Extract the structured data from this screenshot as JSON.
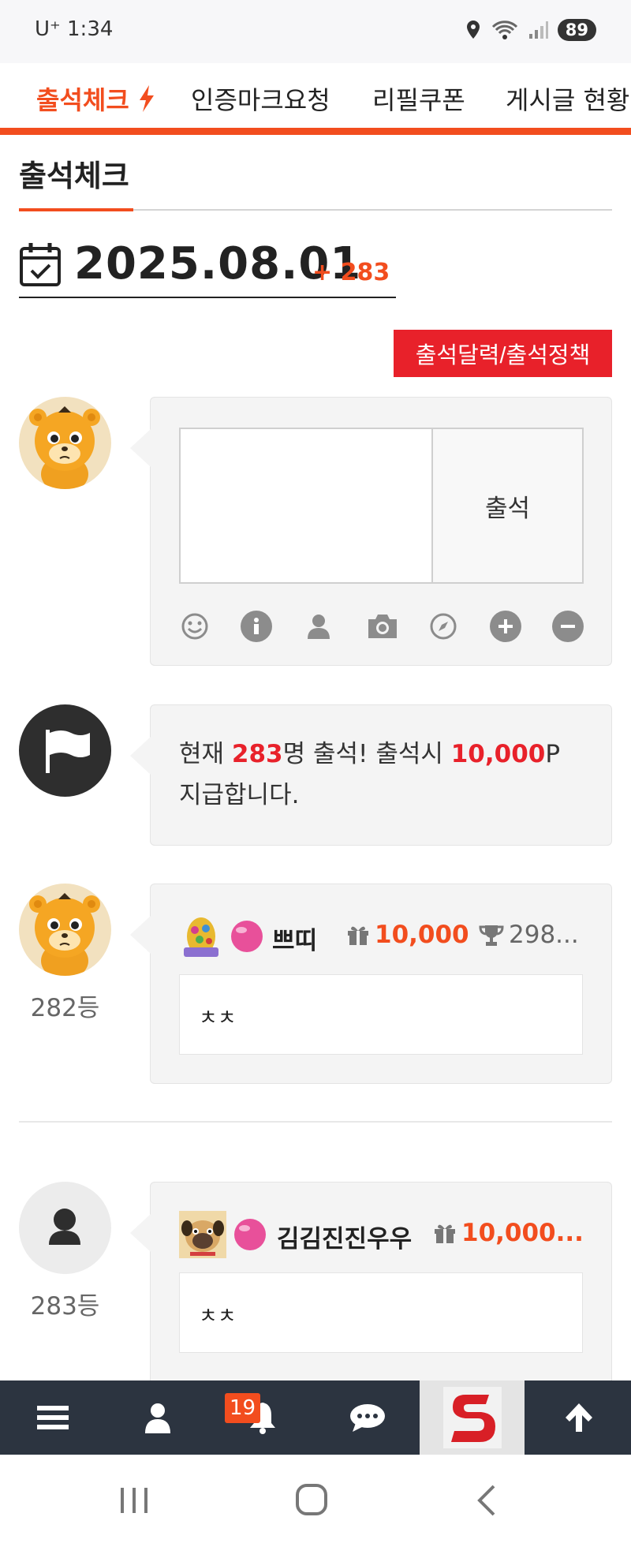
{
  "status_bar": {
    "carrier_time": "U⁺ 1:34",
    "battery": "89"
  },
  "top_nav": {
    "tabs": [
      {
        "label": "출석체크"
      },
      {
        "label": "인증마크요청"
      },
      {
        "label": "리필쿠폰"
      },
      {
        "label": "게시글 현황"
      }
    ]
  },
  "page": {
    "title": "출석체크"
  },
  "date": {
    "value": "2025.08.01",
    "count": "+ 283"
  },
  "policy_button": "출석달력/출석정책",
  "compose": {
    "submit_label": "출석"
  },
  "info": {
    "prefix": "현재 ",
    "count": "283",
    "middle": "명 출석! 출석시 ",
    "points": "10,000",
    "suffix": "P 지급합니다."
  },
  "entries": [
    {
      "rank": "282등",
      "nickname": "쁘띠",
      "points": "10,000",
      "trophy": "298...",
      "comment": "ㅊㅊ"
    },
    {
      "rank": "283등",
      "nickname": "김김진진우우",
      "points": "10,000...",
      "comment": "ㅊㅊ"
    }
  ],
  "bottom_bar": {
    "notification_count": "19"
  },
  "colors": {
    "accent": "#f24d1e",
    "red": "#e8212a",
    "bottom_bar_bg": "#2c3440"
  }
}
